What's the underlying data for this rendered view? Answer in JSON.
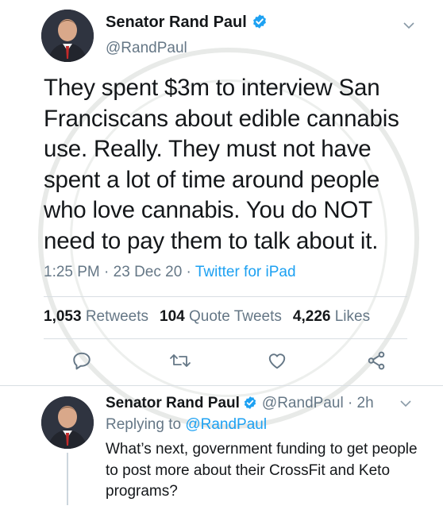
{
  "tweet": {
    "author_name": "Senator Rand Paul",
    "handle": "@RandPaul",
    "text": "They spent $3m to interview San Franciscans about edible cannabis use. Really. They must not have spent a lot of time around people who love cannabis. You do NOT need to pay them to talk about it.",
    "time": "1:25 PM",
    "date": "23 Dec 20",
    "source": "Twitter for iPad",
    "separator": " · ",
    "retweets_count": "1,053",
    "retweets_label": "Retweets",
    "quote_count": "104",
    "quote_label": "Quote Tweets",
    "likes_count": "4,226",
    "likes_label": "Likes",
    "chevron": "⌄"
  },
  "reply": {
    "author_name": "Senator Rand Paul",
    "handle": "@RandPaul",
    "time_ago": "· 2h",
    "replying_label": "Replying to",
    "replying_to": "@RandPaul",
    "text": "What’s next, government funding to get people to post more about their CrossFit and Keto programs?",
    "chevron": "⌄"
  },
  "colors": {
    "text": "#14171a",
    "secondary": "#657786",
    "accent": "#1da1f2",
    "icon": "#657786",
    "divider": "#d8dee3"
  },
  "icons": [
    "verified-badge-icon",
    "chevron-down-icon",
    "reply-icon",
    "retweet-icon",
    "like-icon",
    "share-icon"
  ]
}
